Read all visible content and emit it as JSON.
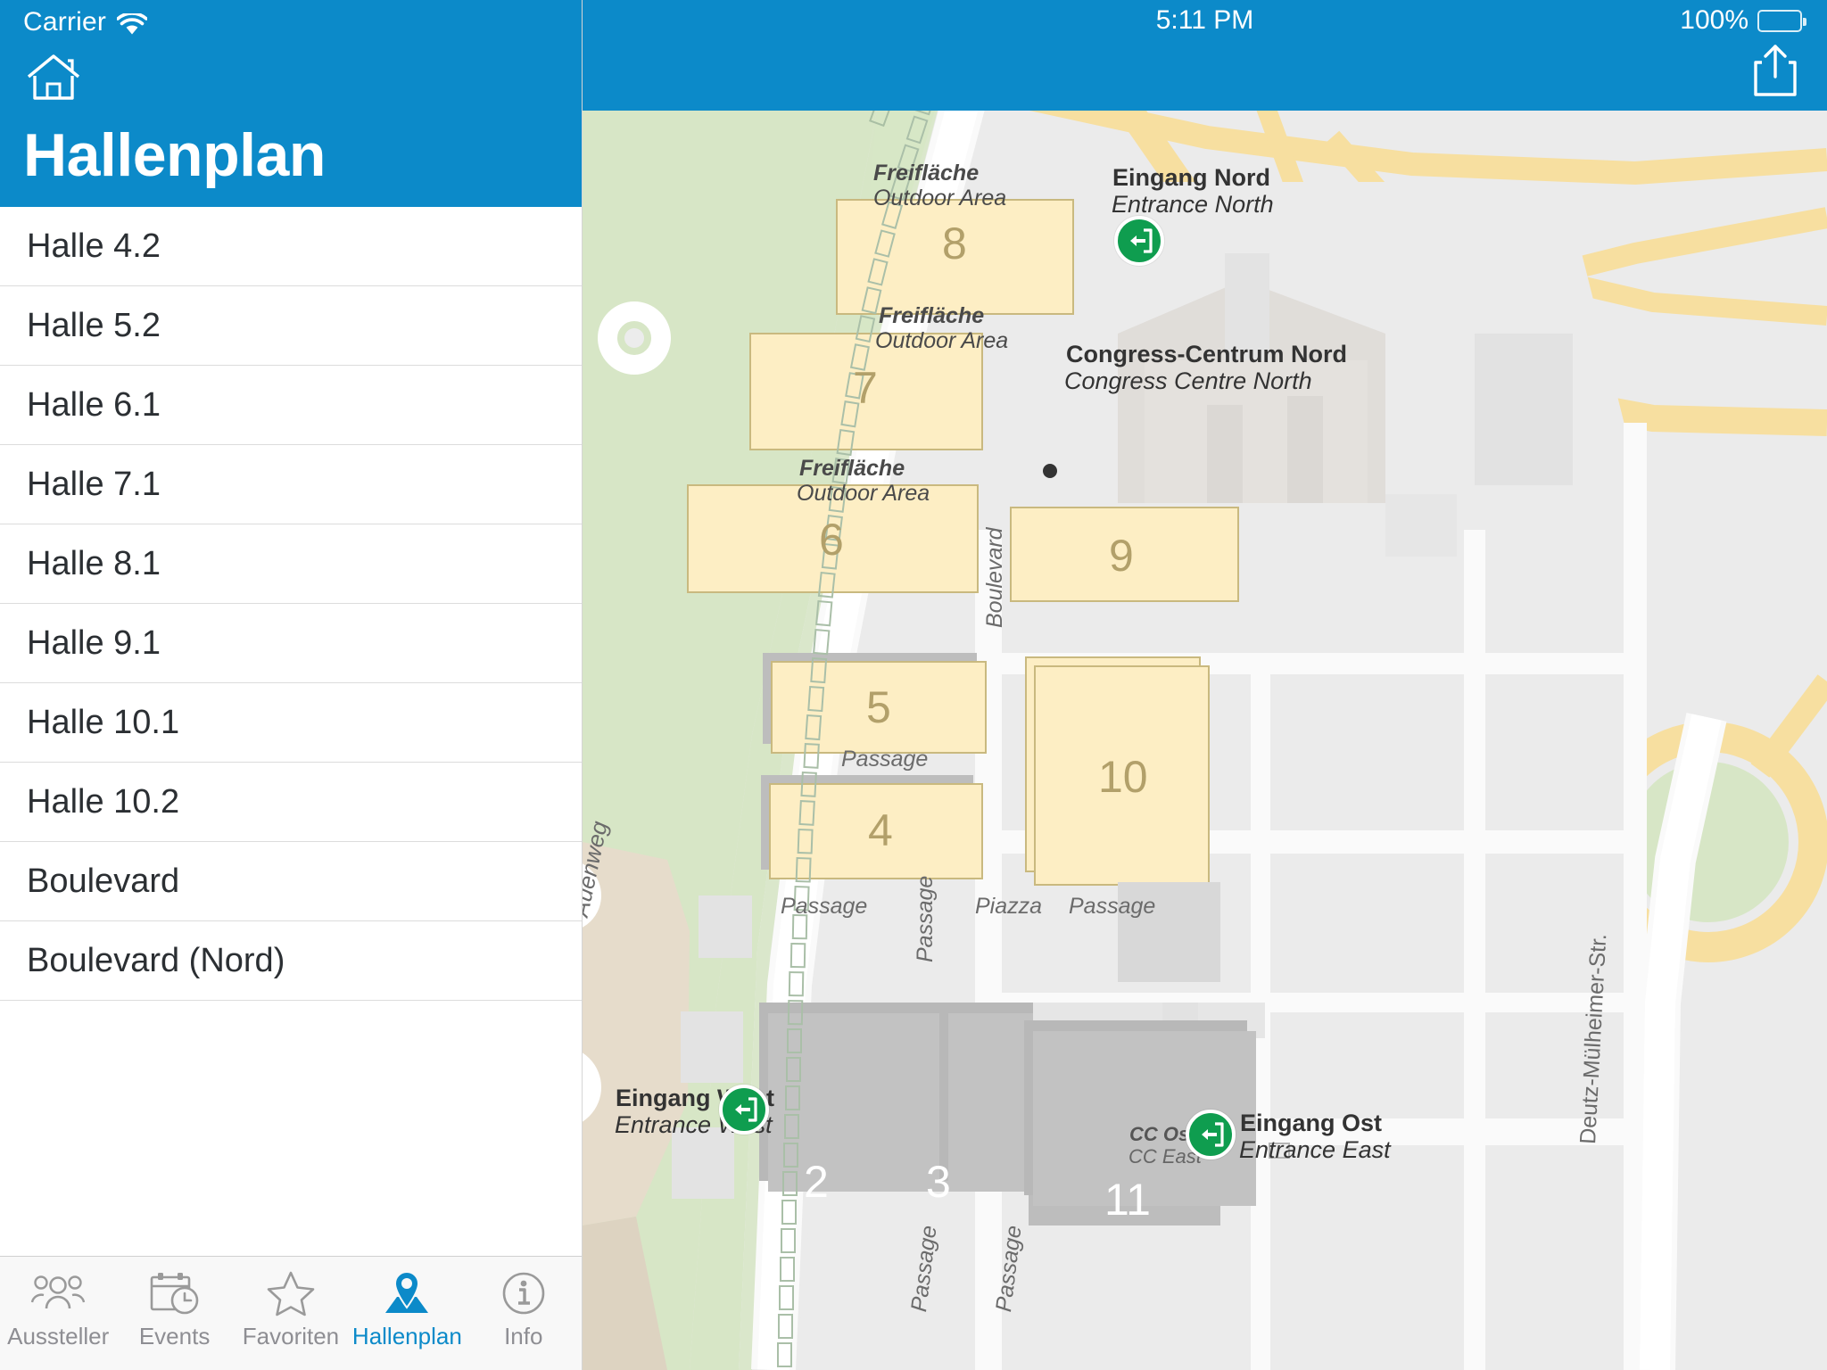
{
  "status_bar": {
    "carrier": "Carrier",
    "wifi_icon": "wifi-icon",
    "time": "5:11 PM",
    "battery_percent": "100%"
  },
  "sidebar": {
    "home_icon": "home-icon",
    "title": "Hallenplan",
    "items": [
      {
        "label": "Halle 4.2"
      },
      {
        "label": "Halle 5.2"
      },
      {
        "label": "Halle 6.1"
      },
      {
        "label": "Halle 7.1"
      },
      {
        "label": "Halle 8.1"
      },
      {
        "label": "Halle 9.1"
      },
      {
        "label": "Halle 10.1"
      },
      {
        "label": "Halle 10.2"
      },
      {
        "label": "Boulevard"
      },
      {
        "label": "Boulevard (Nord)"
      }
    ]
  },
  "tabbar": {
    "items": [
      {
        "label": "Aussteller",
        "icon": "people-icon",
        "active": false
      },
      {
        "label": "Events",
        "icon": "calendar-clock-icon",
        "active": false
      },
      {
        "label": "Favoriten",
        "icon": "star-icon",
        "active": false
      },
      {
        "label": "Hallenplan",
        "icon": "map-pin-icon",
        "active": true
      },
      {
        "label": "Info",
        "icon": "info-circle-icon",
        "active": false
      }
    ]
  },
  "toolbar": {
    "share_icon": "share-icon"
  },
  "map": {
    "halls": [
      {
        "number": "8",
        "highlight": true
      },
      {
        "number": "7",
        "highlight": true
      },
      {
        "number": "6",
        "highlight": true
      },
      {
        "number": "9",
        "highlight": true
      },
      {
        "number": "5",
        "highlight": true
      },
      {
        "number": "4",
        "highlight": true
      },
      {
        "number": "10",
        "highlight": true
      },
      {
        "number": "2",
        "highlight": false
      },
      {
        "number": "3",
        "highlight": false
      },
      {
        "number": "11",
        "highlight": false
      }
    ],
    "area_labels": [
      {
        "de": "Freifläche",
        "en": "Outdoor Area"
      },
      {
        "de": "Freifläche",
        "en": "Outdoor Area"
      },
      {
        "de": "Freifläche",
        "en": "Outdoor Area"
      }
    ],
    "pois": [
      {
        "de": "Congress-Centrum Nord",
        "en": "Congress Centre North",
        "marker": "dot-marker"
      },
      {
        "de": "CC Ost",
        "en": "CC East",
        "marker": "none"
      }
    ],
    "entrances": [
      {
        "de": "Eingang Nord",
        "en": "Entrance North",
        "icon": "exit-door-icon"
      },
      {
        "de": "Eingang West",
        "en": "Entrance West",
        "icon": "exit-door-icon"
      },
      {
        "de": "Eingang Ost",
        "en": "Entrance East",
        "icon": "exit-door-icon"
      }
    ],
    "streets": [
      {
        "name": "Auenweg"
      },
      {
        "name": "Boulevard"
      },
      {
        "name": "Deutz-Mülheimer-Str."
      }
    ],
    "passages": [
      {
        "name": "Passage"
      },
      {
        "name": "Passage"
      },
      {
        "name": "Passage"
      },
      {
        "name": "Passage"
      },
      {
        "name": "Passage"
      },
      {
        "name": "Passage"
      }
    ],
    "plaza": {
      "name": "Piazza"
    }
  },
  "colors": {
    "accent": "#0c8ac9",
    "hall_fill": "#fdeec4",
    "hall_stroke": "#c9b97f",
    "hall_grey": "#c2c2c2",
    "green_area": "#d7e6c6",
    "entrance_green": "#0f9d4f",
    "road_yellow": "#f7dfa0"
  }
}
